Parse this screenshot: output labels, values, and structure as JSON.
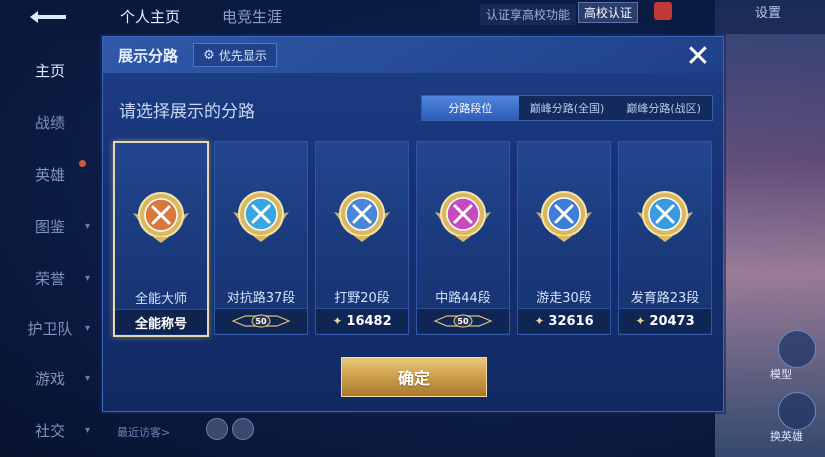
{
  "topbar": {
    "tabs": [
      "个人主页",
      "电竞生涯"
    ],
    "verify_text": "认证享高校功能",
    "verify_badge": "高校认证",
    "settings": "设置"
  },
  "sidebar": {
    "items": [
      {
        "label": "主页"
      },
      {
        "label": "战绩"
      },
      {
        "label": "英雄"
      },
      {
        "label": "图鉴"
      },
      {
        "label": "荣誉"
      },
      {
        "label": "护卫队"
      },
      {
        "label": "游戏"
      },
      {
        "label": "社交"
      }
    ],
    "visitor_label": "最近访客>"
  },
  "right_side": {
    "btn1_label": "模型",
    "btn2_label": "换英雄"
  },
  "modal": {
    "title": "展示分路",
    "priority_label": "优先显示",
    "close_icon": "close-icon",
    "prompt": "请选择展示的分路",
    "tabs": [
      "分路段位",
      "巅峰分路(全国)",
      "巅峰分路(战区)"
    ],
    "active_tab": 0,
    "cards": [
      {
        "name": "全能大师",
        "footer": "全能称号",
        "footer_type": "text",
        "selected": true,
        "emblem_color": "#d9783a"
      },
      {
        "name": "对抗路37段",
        "footer": "50",
        "footer_type": "rank",
        "selected": false,
        "emblem_color": "#3aa6e0"
      },
      {
        "name": "打野20段",
        "footer": "16482",
        "footer_type": "points",
        "selected": false,
        "emblem_color": "#4a86d8"
      },
      {
        "name": "中路44段",
        "footer": "50",
        "footer_type": "rank",
        "selected": false,
        "emblem_color": "#c64ac0"
      },
      {
        "name": "游走30段",
        "footer": "32616",
        "footer_type": "points",
        "selected": false,
        "emblem_color": "#3f7ed8"
      },
      {
        "name": "发育路23段",
        "footer": "20473",
        "footer_type": "points",
        "selected": false,
        "emblem_color": "#3a9ae0"
      }
    ],
    "confirm_label": "确定"
  }
}
